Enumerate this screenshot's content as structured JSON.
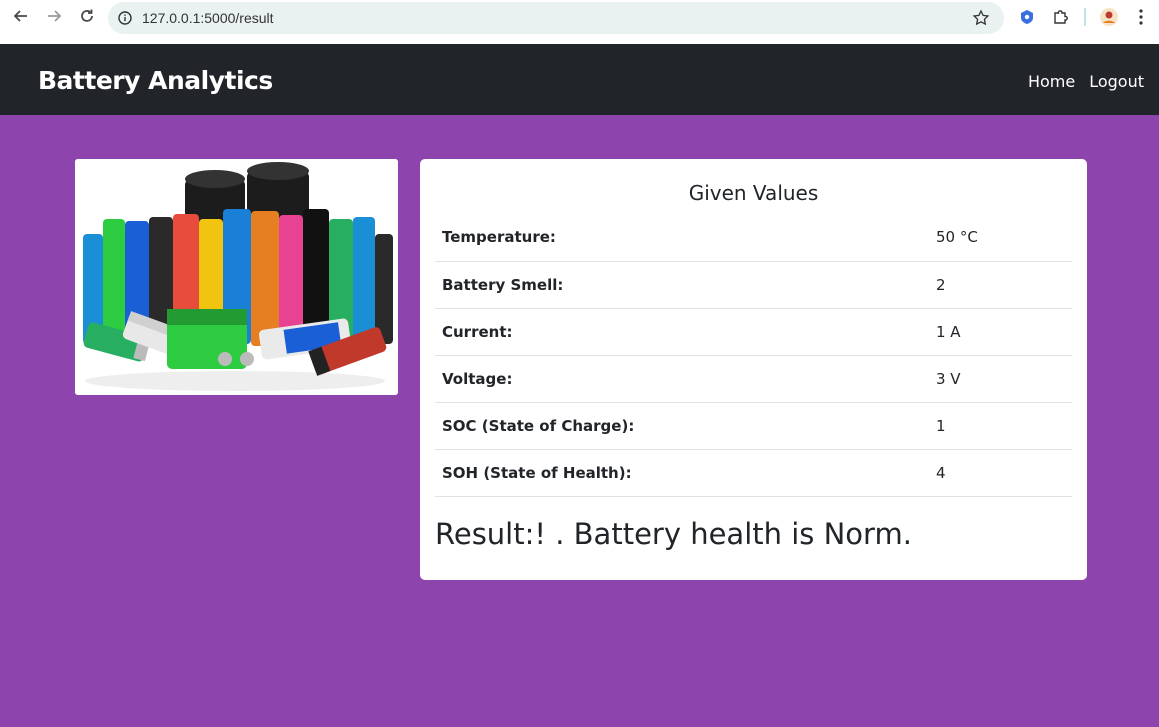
{
  "browser": {
    "url": "127.0.0.1:5000/result"
  },
  "navbar": {
    "brand": "Battery Analytics",
    "links": [
      "Home",
      "Logout"
    ]
  },
  "card": {
    "heading": "Given Values",
    "rows": [
      {
        "label": "Temperature:",
        "value": "50 °C"
      },
      {
        "label": "Battery Smell:",
        "value": "2"
      },
      {
        "label": "Current:",
        "value": "1 A"
      },
      {
        "label": "Voltage:",
        "value": "3 V"
      },
      {
        "label": "SOC (State of Charge):",
        "value": "1"
      },
      {
        "label": "SOH (State of Health):",
        "value": "4"
      }
    ],
    "result": "Result:! . Battery health is Norm."
  },
  "colors": {
    "page_background": "#8e44ad",
    "navbar_background": "#212529",
    "card_background": "#ffffff"
  },
  "icons": [
    "back-icon",
    "forward-icon",
    "reload-icon",
    "site-info-icon",
    "bookmark-star-icon",
    "extension-badge-icon",
    "extensions-puzzle-icon",
    "profile-avatar-icon",
    "kebab-menu-icon"
  ]
}
